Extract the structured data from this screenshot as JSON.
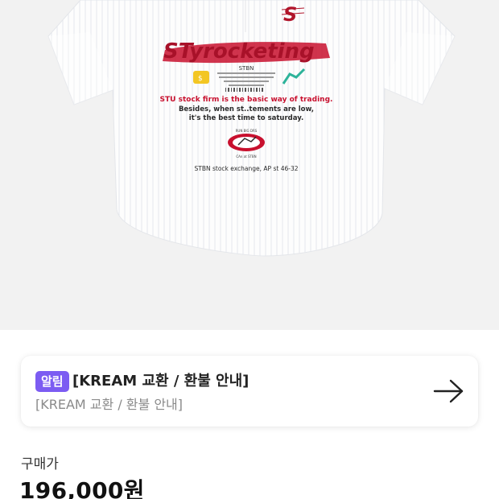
{
  "product_image": {
    "graphic_name": "shirt-graphic",
    "print_title": "STyrocketing",
    "print_subtitle": "STBN",
    "print_line1": "STU stock firm is the basic way of trading.",
    "print_line2": "Besides, when st..tements are low,",
    "print_line3": "it's the best time to saturday.",
    "print_footer": "STBN stock exchange, AP st 46-32",
    "print_mark_top": "RUN BIG DRS",
    "print_mark_bottom": "CAn at STBN",
    "colors": {
      "background": "#f2f2f2",
      "shirt": "#fdfdfd",
      "print_red": "#c8102e",
      "print_dark": "#2b2b2b"
    }
  },
  "notice": {
    "badge": "알림",
    "title": "[KREAM 교환 / 환불 안내]",
    "subtitle": "[KREAM 교환 / 환불 안내]",
    "icon": "arrow-right-icon",
    "colors": {
      "badge": "#7c5cf2"
    }
  },
  "price": {
    "label": "구매가",
    "value": "196,000원"
  }
}
